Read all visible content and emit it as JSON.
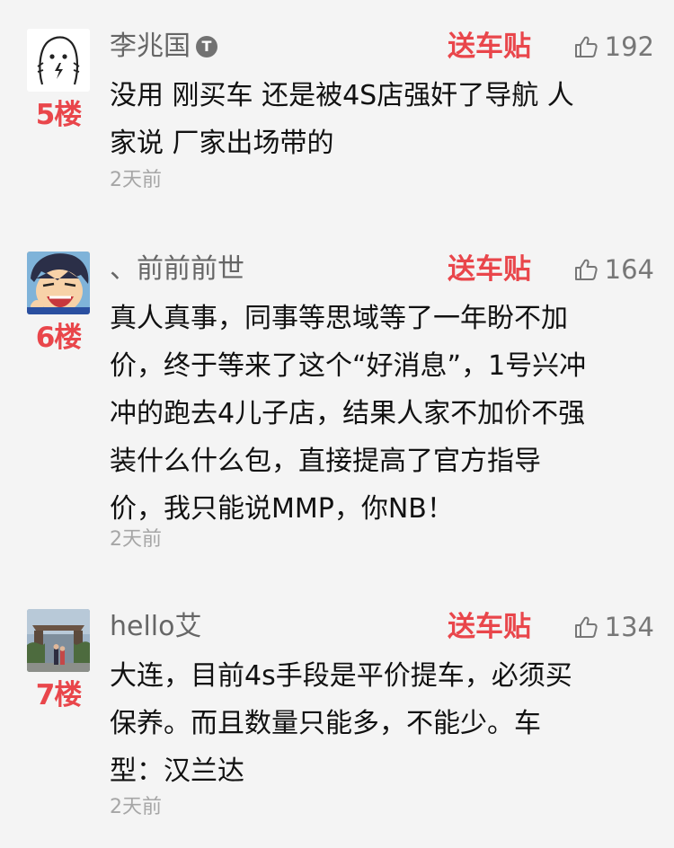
{
  "comments": [
    {
      "floor": "5楼",
      "username": "李兆国",
      "badge": "T",
      "tag": "送车贴",
      "likes": "192",
      "avatar": "ghost-doodle-avatar",
      "lines": [
        "没用 刚买车 还是被4S店强奸了导航 人",
        "家说 厂家出场带的"
      ],
      "time": "2天前"
    },
    {
      "floor": "6楼",
      "username": "、前前前世",
      "tag": "送车贴",
      "likes": "164",
      "avatar": "cartoon-boy-avatar",
      "lines": [
        "真人真事，同事等思域等了一年盼不加",
        "价，终于等来了这个“好消息”，1号兴冲",
        "冲的跑去4儿子店，结果人家不加价不强",
        "装什么什么包，直接提高了官方指导",
        "价，我只能说MMP，你NB！"
      ],
      "time": "2天前"
    },
    {
      "floor": "7楼",
      "username": "hello艾",
      "tag": "送车贴",
      "likes": "134",
      "avatar": "gate-photo-avatar",
      "lines": [
        "大连，目前4s手段是平价提车，必须买",
        "保养。而且数量只能多，不能少。车",
        "型：汉兰达"
      ],
      "time": "2天前"
    }
  ],
  "colors": {
    "background": "#f4f4f4",
    "accent_red": "#e9464b",
    "body_text": "#111111",
    "name_text": "#666666",
    "meta_text": "#a6a6a6"
  }
}
